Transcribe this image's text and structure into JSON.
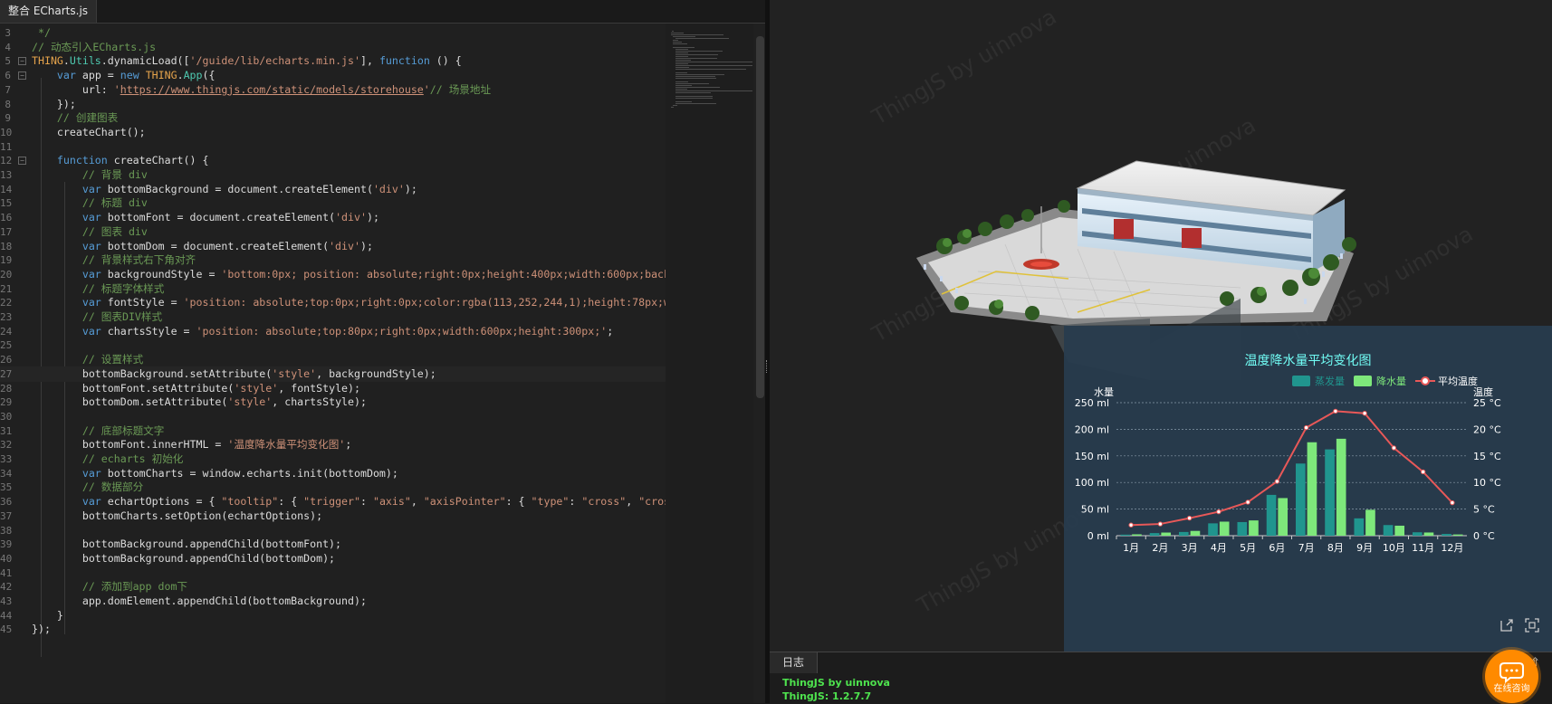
{
  "tab": {
    "title": "整合 ECharts.js"
  },
  "code": [
    {
      "n": "3",
      "fold": false,
      "html": " <span class=\"c\">*/</span>"
    },
    {
      "n": "4",
      "fold": false,
      "html": "<span class=\"c\">// 动态引入ECharts.js</span>"
    },
    {
      "n": "5",
      "fold": true,
      "html": "<span class=\"o\">THING</span>.<span class=\"g\">Utils</span>.dynamicLoad([<span class=\"s\">'/guide/lib/echarts.min.js'</span>], <span class=\"k\">function</span> () {"
    },
    {
      "n": "6",
      "fold": true,
      "html": "    <span class=\"k\">var</span> app = <span class=\"k\">new</span> <span class=\"o\">THING</span>.<span class=\"g\">App</span>({"
    },
    {
      "n": "7",
      "fold": false,
      "html": "        url: <span class=\"s\">'</span><span class=\"u\">https://www.thingjs.com/static/models/storehouse</span><span class=\"s\">'</span><span class=\"c\">// 场景地址</span>"
    },
    {
      "n": "8",
      "fold": false,
      "html": "    });"
    },
    {
      "n": "9",
      "fold": false,
      "html": "    <span class=\"c\">// 创建图表</span>"
    },
    {
      "n": "10",
      "fold": false,
      "html": "    createChart();"
    },
    {
      "n": "11",
      "fold": false,
      "html": ""
    },
    {
      "n": "12",
      "fold": true,
      "html": "    <span class=\"k\">function</span> createChart() {"
    },
    {
      "n": "13",
      "fold": false,
      "html": "        <span class=\"c\">// 背景 div</span>"
    },
    {
      "n": "14",
      "fold": false,
      "html": "        <span class=\"k\">var</span> bottomBackground = document.createElement(<span class=\"s\">'div'</span>);"
    },
    {
      "n": "15",
      "fold": false,
      "html": "        <span class=\"c\">// 标题 div</span>"
    },
    {
      "n": "16",
      "fold": false,
      "html": "        <span class=\"k\">var</span> bottomFont = document.createElement(<span class=\"s\">'div'</span>);"
    },
    {
      "n": "17",
      "fold": false,
      "html": "        <span class=\"c\">// 图表 div</span>"
    },
    {
      "n": "18",
      "fold": false,
      "html": "        <span class=\"k\">var</span> bottomDom = document.createElement(<span class=\"s\">'div'</span>);"
    },
    {
      "n": "19",
      "fold": false,
      "html": "        <span class=\"c\">// 背景样式右下角对齐</span>"
    },
    {
      "n": "20",
      "fold": false,
      "html": "        <span class=\"k\">var</span> backgroundStyle = <span class=\"s\">'bottom:0px; position: absolute;right:0px;height:400px;width:600px;back</span>"
    },
    {
      "n": "21",
      "fold": false,
      "html": "        <span class=\"c\">// 标题字体样式</span>"
    },
    {
      "n": "22",
      "fold": false,
      "html": "        <span class=\"k\">var</span> fontStyle = <span class=\"s\">'position: absolute;top:0px;right:0px;color:rgba(113,252,244,1);height:78px;w</span>"
    },
    {
      "n": "23",
      "fold": false,
      "html": "        <span class=\"c\">// 图表DIV样式</span>"
    },
    {
      "n": "24",
      "fold": false,
      "html": "        <span class=\"k\">var</span> chartsStyle = <span class=\"s\">'position: absolute;top:80px;right:0px;width:600px;height:300px;'</span>;"
    },
    {
      "n": "25",
      "fold": false,
      "html": ""
    },
    {
      "n": "26",
      "fold": false,
      "html": "        <span class=\"c\">// 设置样式</span>"
    },
    {
      "n": "27",
      "fold": false,
      "html": "        bottomBackground.setAttribute(<span class=\"s\">'style'</span>, backgroundStyle);"
    },
    {
      "n": "28",
      "fold": false,
      "html": "        bottomFont.setAttribute(<span class=\"s\">'style'</span>, fontStyle);"
    },
    {
      "n": "29",
      "fold": false,
      "html": "        bottomDom.setAttribute(<span class=\"s\">'style'</span>, chartsStyle);"
    },
    {
      "n": "30",
      "fold": false,
      "html": ""
    },
    {
      "n": "31",
      "fold": false,
      "html": "        <span class=\"c\">// 底部标题文字</span>"
    },
    {
      "n": "32",
      "fold": false,
      "html": "        bottomFont.innerHTML = <span class=\"s\">'温度降水量平均变化图'</span>;"
    },
    {
      "n": "33",
      "fold": false,
      "html": "        <span class=\"c\">// echarts 初始化</span>"
    },
    {
      "n": "34",
      "fold": false,
      "html": "        <span class=\"k\">var</span> bottomCharts = window.echarts.init(bottomDom);"
    },
    {
      "n": "35",
      "fold": false,
      "html": "        <span class=\"c\">// 数据部分</span>"
    },
    {
      "n": "36",
      "fold": false,
      "html": "        <span class=\"k\">var</span> echartOptions = { <span class=\"s\">\"tooltip\"</span>: { <span class=\"s\">\"trigger\"</span>: <span class=\"s\">\"axis\"</span>, <span class=\"s\">\"axisPointer\"</span>: { <span class=\"s\">\"type\"</span>: <span class=\"s\">\"cross\"</span>, <span class=\"s\">\"cros</span>"
    },
    {
      "n": "37",
      "fold": false,
      "html": "        bottomCharts.setOption(echartOptions);"
    },
    {
      "n": "38",
      "fold": false,
      "html": ""
    },
    {
      "n": "39",
      "fold": false,
      "html": "        bottomBackground.appendChild(bottomFont);"
    },
    {
      "n": "40",
      "fold": false,
      "html": "        bottomBackground.appendChild(bottomDom);"
    },
    {
      "n": "41",
      "fold": false,
      "html": ""
    },
    {
      "n": "42",
      "fold": false,
      "html": "        <span class=\"c\">// 添加到app dom下</span>"
    },
    {
      "n": "43",
      "fold": false,
      "html": "        app.domElement.appendChild(bottomBackground);"
    },
    {
      "n": "44",
      "fold": false,
      "html": "    }"
    },
    {
      "n": "45",
      "fold": false,
      "html": "});"
    }
  ],
  "active_line": "27",
  "watermark": "ThingJS by uinnova",
  "chart_data": {
    "type": "bar",
    "title": "温度降水量平均变化图",
    "categories": [
      "1月",
      "2月",
      "3月",
      "4月",
      "5月",
      "6月",
      "7月",
      "8月",
      "9月",
      "10月",
      "11月",
      "12月"
    ],
    "series": [
      {
        "name": "蒸发量",
        "type": "bar",
        "color": "#20958e",
        "values": [
          2.0,
          4.9,
          7.0,
          23.2,
          25.6,
          76.7,
          135.6,
          162.2,
          32.6,
          20.0,
          6.4,
          3.3
        ]
      },
      {
        "name": "降水量",
        "type": "bar",
        "color": "#7ee87b",
        "values": [
          2.6,
          5.9,
          9.0,
          26.4,
          28.7,
          70.7,
          175.6,
          182.2,
          48.7,
          18.8,
          6.0,
          2.3
        ]
      },
      {
        "name": "平均温度",
        "type": "line",
        "color": "#e85858",
        "values": [
          2.0,
          2.2,
          3.3,
          4.5,
          6.3,
          10.2,
          20.3,
          23.4,
          23.0,
          16.5,
          12.0,
          6.2
        ]
      }
    ],
    "ylabel": "水量",
    "y2label": "温度",
    "ylim": [
      0,
      250
    ],
    "y2lim": [
      0,
      25
    ],
    "yticks": [
      "0 ml",
      "50 ml",
      "100 ml",
      "150 ml",
      "200 ml",
      "250 ml"
    ],
    "y2ticks": [
      "0 °C",
      "5 °C",
      "10 °C",
      "15 °C",
      "20 °C",
      "25 °C"
    ],
    "legend_position": "top-right",
    "grid": true
  },
  "log": {
    "tab": "日志",
    "lines": [
      "ThingJS by uinnova",
      "ThingJS: 1.2.7.7"
    ]
  },
  "consult": {
    "label": "在线咨询"
  },
  "colors": {
    "accent": "#71fcf4",
    "consult": "#ff8a00",
    "log_text": "#4ee34e"
  }
}
